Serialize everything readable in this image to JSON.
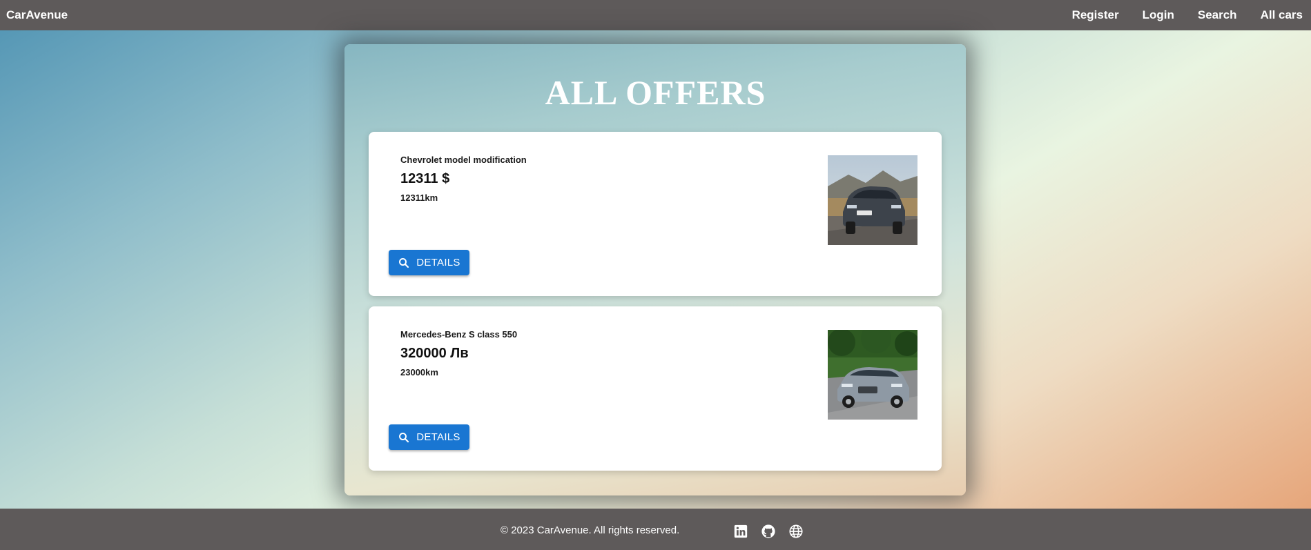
{
  "navbar": {
    "brand": "CarAvenue",
    "links": [
      "Register",
      "Login",
      "Search",
      "All cars"
    ]
  },
  "page": {
    "title": "ALL OFFERS"
  },
  "offers": [
    {
      "title": "Chevrolet model modification",
      "price": "12311 $",
      "mileage": "12311km",
      "button_label": "DETAILS",
      "image": "dark-grey-suv-photo"
    },
    {
      "title": "Mercedes-Benz S class 550",
      "price": "320000 Лв",
      "mileage": "23000km",
      "button_label": "DETAILS",
      "image": "silver-sedan-photo"
    }
  ],
  "footer": {
    "copyright": "© 2023 CarAvenue. All rights reserved.",
    "icons": [
      "linkedin-icon",
      "github-icon",
      "globe-icon"
    ]
  },
  "colors": {
    "nav_bg": "#5e5a5a",
    "button_bg": "#1976d2",
    "card_bg": "#ffffff"
  }
}
